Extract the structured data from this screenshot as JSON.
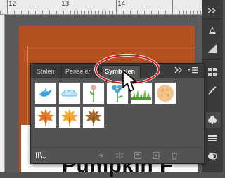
{
  "ruler": {
    "top_labels": [
      "12",
      "13",
      "14"
    ]
  },
  "artwork": {
    "headline_fragment": "Pumpkin F"
  },
  "panel": {
    "tabs": [
      {
        "label": "Stalen"
      },
      {
        "label": "Penselen"
      },
      {
        "label": "Symbolen",
        "active": true
      }
    ],
    "symbols": [
      {
        "name": "bird-symbol",
        "icon": "blue-bird"
      },
      {
        "name": "cloud-symbol",
        "icon": "cloud"
      },
      {
        "name": "flower-symbol",
        "icon": "flower-stem"
      },
      {
        "name": "blue-flower-symbol",
        "icon": "blue-flower"
      },
      {
        "name": "grass-symbol",
        "icon": "grass"
      },
      {
        "name": "orange-circle-symbol",
        "icon": "orange-texture-circle"
      },
      {
        "name": "orange-leaf-symbol",
        "icon": "maple-leaf-orange"
      },
      {
        "name": "yellow-leaf-symbol",
        "icon": "maple-leaf-yellow"
      },
      {
        "name": "brown-leaf-symbol",
        "icon": "maple-leaf-brown"
      }
    ]
  },
  "colors": {
    "highlight": "#d11f27",
    "artboard": "#b4511f",
    "panel_bg": "#535353"
  }
}
